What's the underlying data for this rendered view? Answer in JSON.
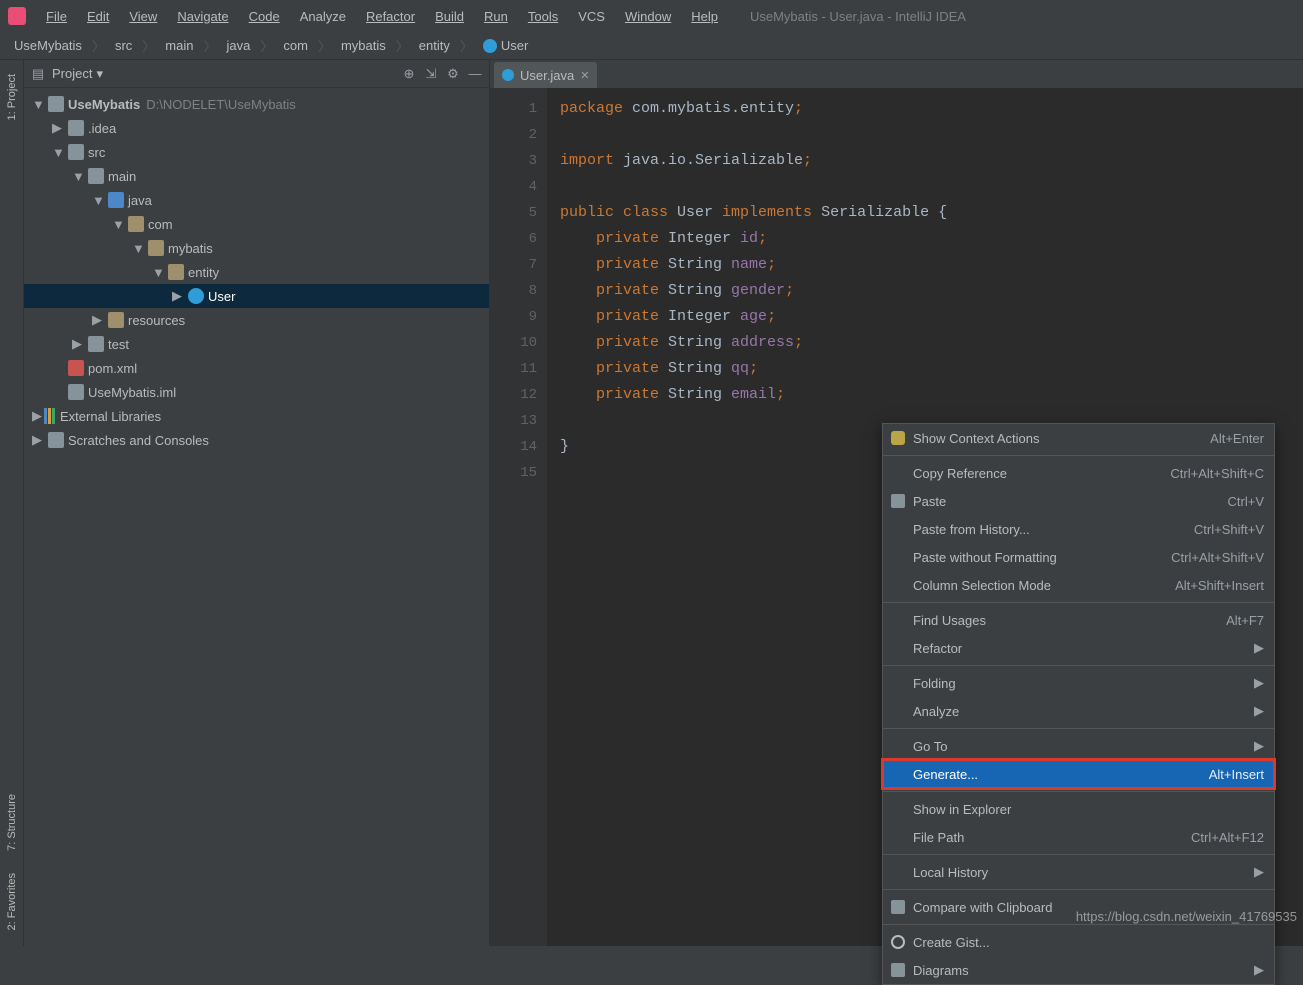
{
  "app": {
    "title": "UseMybatis - User.java - IntelliJ IDEA"
  },
  "menu": [
    "File",
    "Edit",
    "View",
    "Navigate",
    "Code",
    "Analyze",
    "Refactor",
    "Build",
    "Run",
    "Tools",
    "VCS",
    "Window",
    "Help"
  ],
  "breadcrumb": [
    "UseMybatis",
    "src",
    "main",
    "java",
    "com",
    "mybatis",
    "entity",
    "User"
  ],
  "project_panel": {
    "title": "Project"
  },
  "tree": {
    "root": {
      "name": "UseMybatis",
      "path": "D:\\NODELET\\UseMybatis"
    },
    "idea": ".idea",
    "src": "src",
    "main": "main",
    "java": "java",
    "com": "com",
    "mybatis": "mybatis",
    "entity": "entity",
    "user": "User",
    "resources": "resources",
    "test": "test",
    "pom": "pom.xml",
    "iml": "UseMybatis.iml",
    "ext": "External Libraries",
    "scratch": "Scratches and Consoles"
  },
  "side_labels": {
    "project": "1: Project",
    "structure": "7: Structure",
    "favorites": "2: Favorites"
  },
  "tab": {
    "name": "User.java"
  },
  "code": {
    "l1a": "package",
    "l1b": " com.mybatis.entity",
    "l1c": ";",
    "l3a": "import",
    "l3b": " java.io.Serializable",
    "l3c": ";",
    "l5a": "public class ",
    "l5b": "User ",
    "l5c": "implements ",
    "l5d": "Serializable {",
    "l6a": "    private ",
    "l6b": "Integer ",
    "l6c": "id",
    "l6d": ";",
    "l7a": "    private ",
    "l7b": "String ",
    "l7c": "name",
    "l7d": ";",
    "l8a": "    private ",
    "l8b": "String ",
    "l8c": "gender",
    "l8d": ";",
    "l9a": "    private ",
    "l9b": "Integer ",
    "l9c": "age",
    "l9d": ";",
    "l10a": "    private ",
    "l10b": "String ",
    "l10c": "address",
    "l10d": ";",
    "l11a": "    private ",
    "l11b": "String ",
    "l11c": "qq",
    "l11d": ";",
    "l12a": "    private ",
    "l12b": "String ",
    "l12c": "email",
    "l12d": ";",
    "l14": "}"
  },
  "gutter": [
    "1",
    "2",
    "3",
    "4",
    "5",
    "6",
    "7",
    "8",
    "9",
    "10",
    "11",
    "12",
    "13",
    "14",
    "15"
  ],
  "ctx": {
    "showContext": {
      "label": "Show Context Actions",
      "sc": "Alt+Enter"
    },
    "copyRef": {
      "label": "Copy Reference",
      "sc": "Ctrl+Alt+Shift+C"
    },
    "paste": {
      "label": "Paste",
      "sc": "Ctrl+V"
    },
    "pasteHist": {
      "label": "Paste from History...",
      "sc": "Ctrl+Shift+V"
    },
    "pasteNoFmt": {
      "label": "Paste without Formatting",
      "sc": "Ctrl+Alt+Shift+V"
    },
    "colSel": {
      "label": "Column Selection Mode",
      "sc": "Alt+Shift+Insert"
    },
    "findUsages": {
      "label": "Find Usages",
      "sc": "Alt+F7"
    },
    "refactor": {
      "label": "Refactor"
    },
    "folding": {
      "label": "Folding"
    },
    "analyze": {
      "label": "Analyze"
    },
    "goto": {
      "label": "Go To"
    },
    "generate": {
      "label": "Generate...",
      "sc": "Alt+Insert"
    },
    "showExplorer": {
      "label": "Show in Explorer"
    },
    "filePath": {
      "label": "File Path",
      "sc": "Ctrl+Alt+F12"
    },
    "localHist": {
      "label": "Local History"
    },
    "cmpClip": {
      "label": "Compare with Clipboard"
    },
    "createGist": {
      "label": "Create Gist..."
    },
    "diagrams": {
      "label": "Diagrams"
    }
  },
  "watermark": "https://blog.csdn.net/weixin_41769535"
}
